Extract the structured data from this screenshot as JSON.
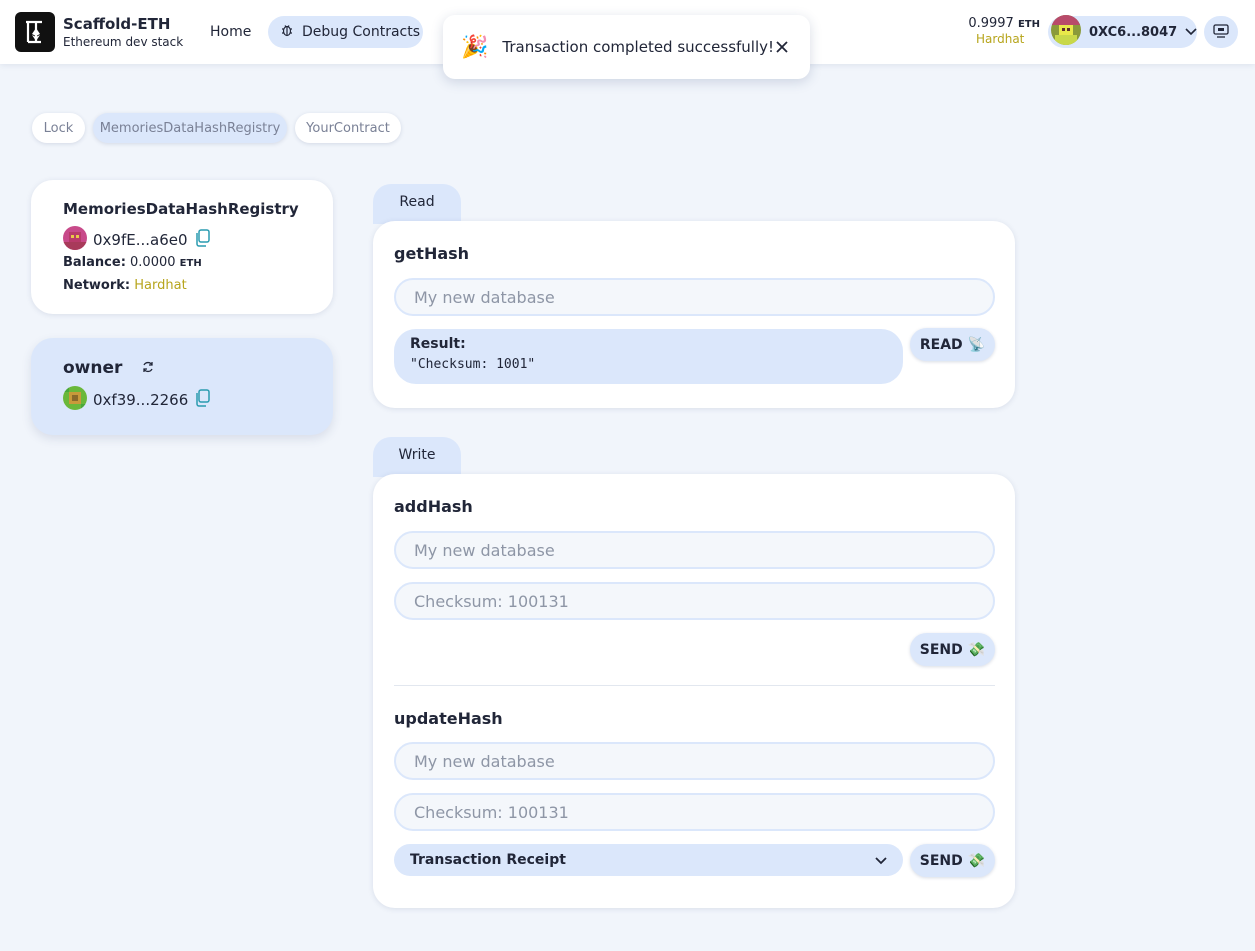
{
  "header": {
    "brand_title": "Scaffold-ETH",
    "brand_subtitle": "Ethereum dev stack",
    "nav": {
      "home": "Home",
      "debug": "Debug Contracts"
    },
    "balance_value": "0.9997",
    "balance_unit": "ETH",
    "network": "Hardhat",
    "wallet_address": "0XC6...8047"
  },
  "toast": {
    "message": "Transaction completed successfully!",
    "emoji": "🎉"
  },
  "contract_tabs": [
    "Lock",
    "MemoriesDataHashRegistry",
    "YourContract"
  ],
  "contract": {
    "name": "MemoriesDataHashRegistry",
    "address": "0x9fE...a6e0",
    "balance_label": "Balance:",
    "balance_value": "0.0000",
    "balance_unit": "ETH",
    "network_label": "Network:",
    "network_value": "Hardhat"
  },
  "owner": {
    "label": "owner",
    "address": "0xf39...2266"
  },
  "read": {
    "tab": "Read",
    "fn_name": "getHash",
    "placeholder": "My new database",
    "result_label": "Result:",
    "result_value": "\"Checksum: 1001\"",
    "button": "READ",
    "button_emoji": "📡"
  },
  "write": {
    "tab": "Write",
    "add": {
      "fn_name": "addHash",
      "placeholder1": "My new database",
      "placeholder2": "Checksum: 100131",
      "button": "SEND",
      "button_emoji": "💸"
    },
    "update": {
      "fn_name": "updateHash",
      "placeholder1": "My new database",
      "placeholder2": "Checksum: 100131",
      "receipt": "Transaction Receipt",
      "button": "SEND",
      "button_emoji": "💸"
    }
  },
  "colors": {
    "accent": "#dbe7fb",
    "background": "#f1f5fb",
    "network": "#b7a51c",
    "copy_icon": "#2a9bb0"
  }
}
